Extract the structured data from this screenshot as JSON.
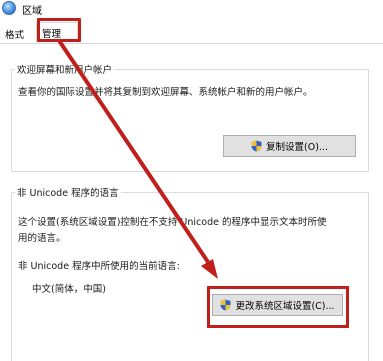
{
  "window": {
    "title": "区域",
    "icon": "globe-icon"
  },
  "tabs": [
    {
      "label": "格式"
    },
    {
      "label": "管理"
    }
  ],
  "welcome_group": {
    "title": "欢迎屏幕和新用户帐户",
    "description": "查看你的国际设置并将其复制到欢迎屏幕、系统帐户和新的用户帐户。",
    "button_label": "复制设置(O)...",
    "button_icon": "uac-shield-icon"
  },
  "unicode_group": {
    "title": "非 Unicode 程序的语言",
    "description_line1": "这个设置(系统区域设置)控制在不支持 Unicode 的程序中显示文本时所使",
    "description_line2": "用的语言。",
    "current_label": "非 Unicode 程序中所使用的当前语言:",
    "current_value": "中文(简体，中国)",
    "button_label": "更改系统区域设置(C)...",
    "button_icon": "uac-shield-icon"
  },
  "annotation": {
    "highlight_color": "#c0201c"
  }
}
